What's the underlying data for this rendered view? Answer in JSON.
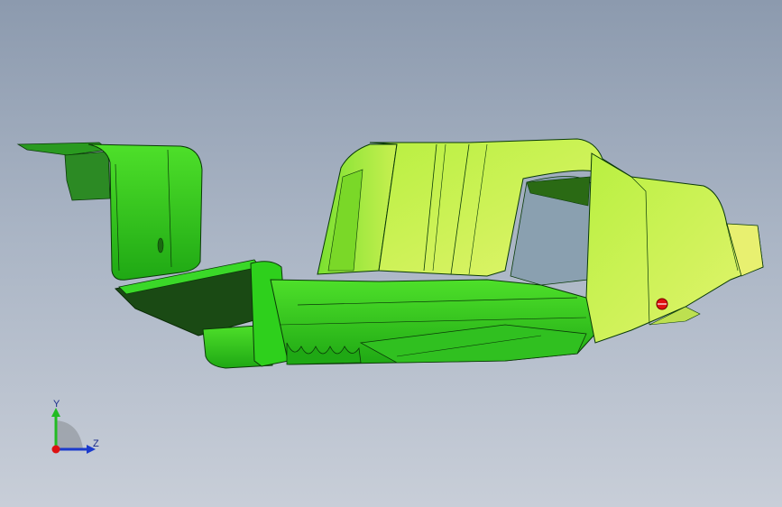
{
  "viewport": {
    "background_top": "#8c9aae",
    "background_bottom": "#c8ced8"
  },
  "model": {
    "part_color_primary": "#2ecc1a",
    "part_color_highlight": "#d8f060",
    "part_color_shadow": "#1a7a10",
    "marker_color": "#e01010"
  },
  "triad": {
    "y_label": "Y",
    "z_label": "Z",
    "y_color": "#22bb22",
    "z_color": "#1a3acc",
    "origin_color": "#dd1111"
  }
}
